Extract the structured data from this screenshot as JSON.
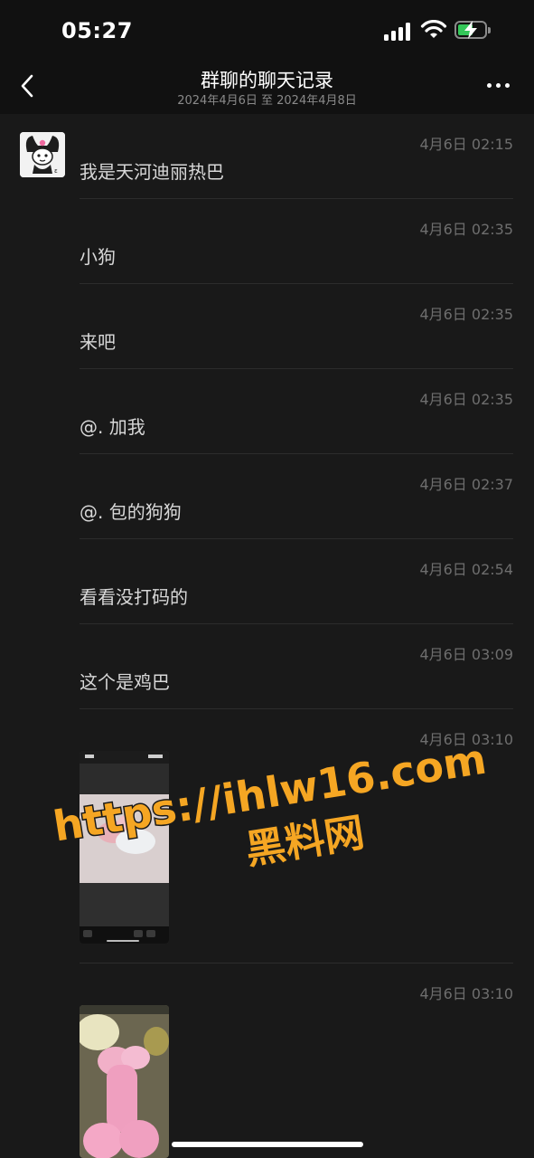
{
  "status": {
    "time": "05:27"
  },
  "nav": {
    "back_icon": "chevron-left-icon",
    "title": "群聊的聊天记录",
    "subtitle": "2024年4月6日 至 2024年4月8日",
    "more_icon": "ellipsis-icon"
  },
  "messages": [
    {
      "time": "4月6日 02:15",
      "text": "我是天河迪丽热巴"
    },
    {
      "time": "4月6日 02:35",
      "text": "小狗"
    },
    {
      "time": "4月6日 02:35",
      "text": "来吧"
    },
    {
      "time": "4月6日 02:35",
      "text": "@. 加我"
    },
    {
      "time": "4月6日 02:37",
      "text": "@. 包的狗狗"
    },
    {
      "time": "4月6日 02:54",
      "text": "看看没打码的"
    },
    {
      "time": "4月6日 03:09",
      "text": "这个是鸡巴"
    },
    {
      "time": "4月6日 03:10",
      "image": "video-screenshot-thumbnail"
    },
    {
      "time": "4月6日 03:10",
      "image": "photo-thumbnail"
    }
  ],
  "watermark": {
    "line1": "https://ihlw16.com",
    "line2": "黑料网"
  },
  "colors": {
    "background": "#191919",
    "bar": "#111111",
    "text": "#d8d8d8",
    "timestamp": "#6e6e6e",
    "watermark_fill": "#f5a623"
  }
}
